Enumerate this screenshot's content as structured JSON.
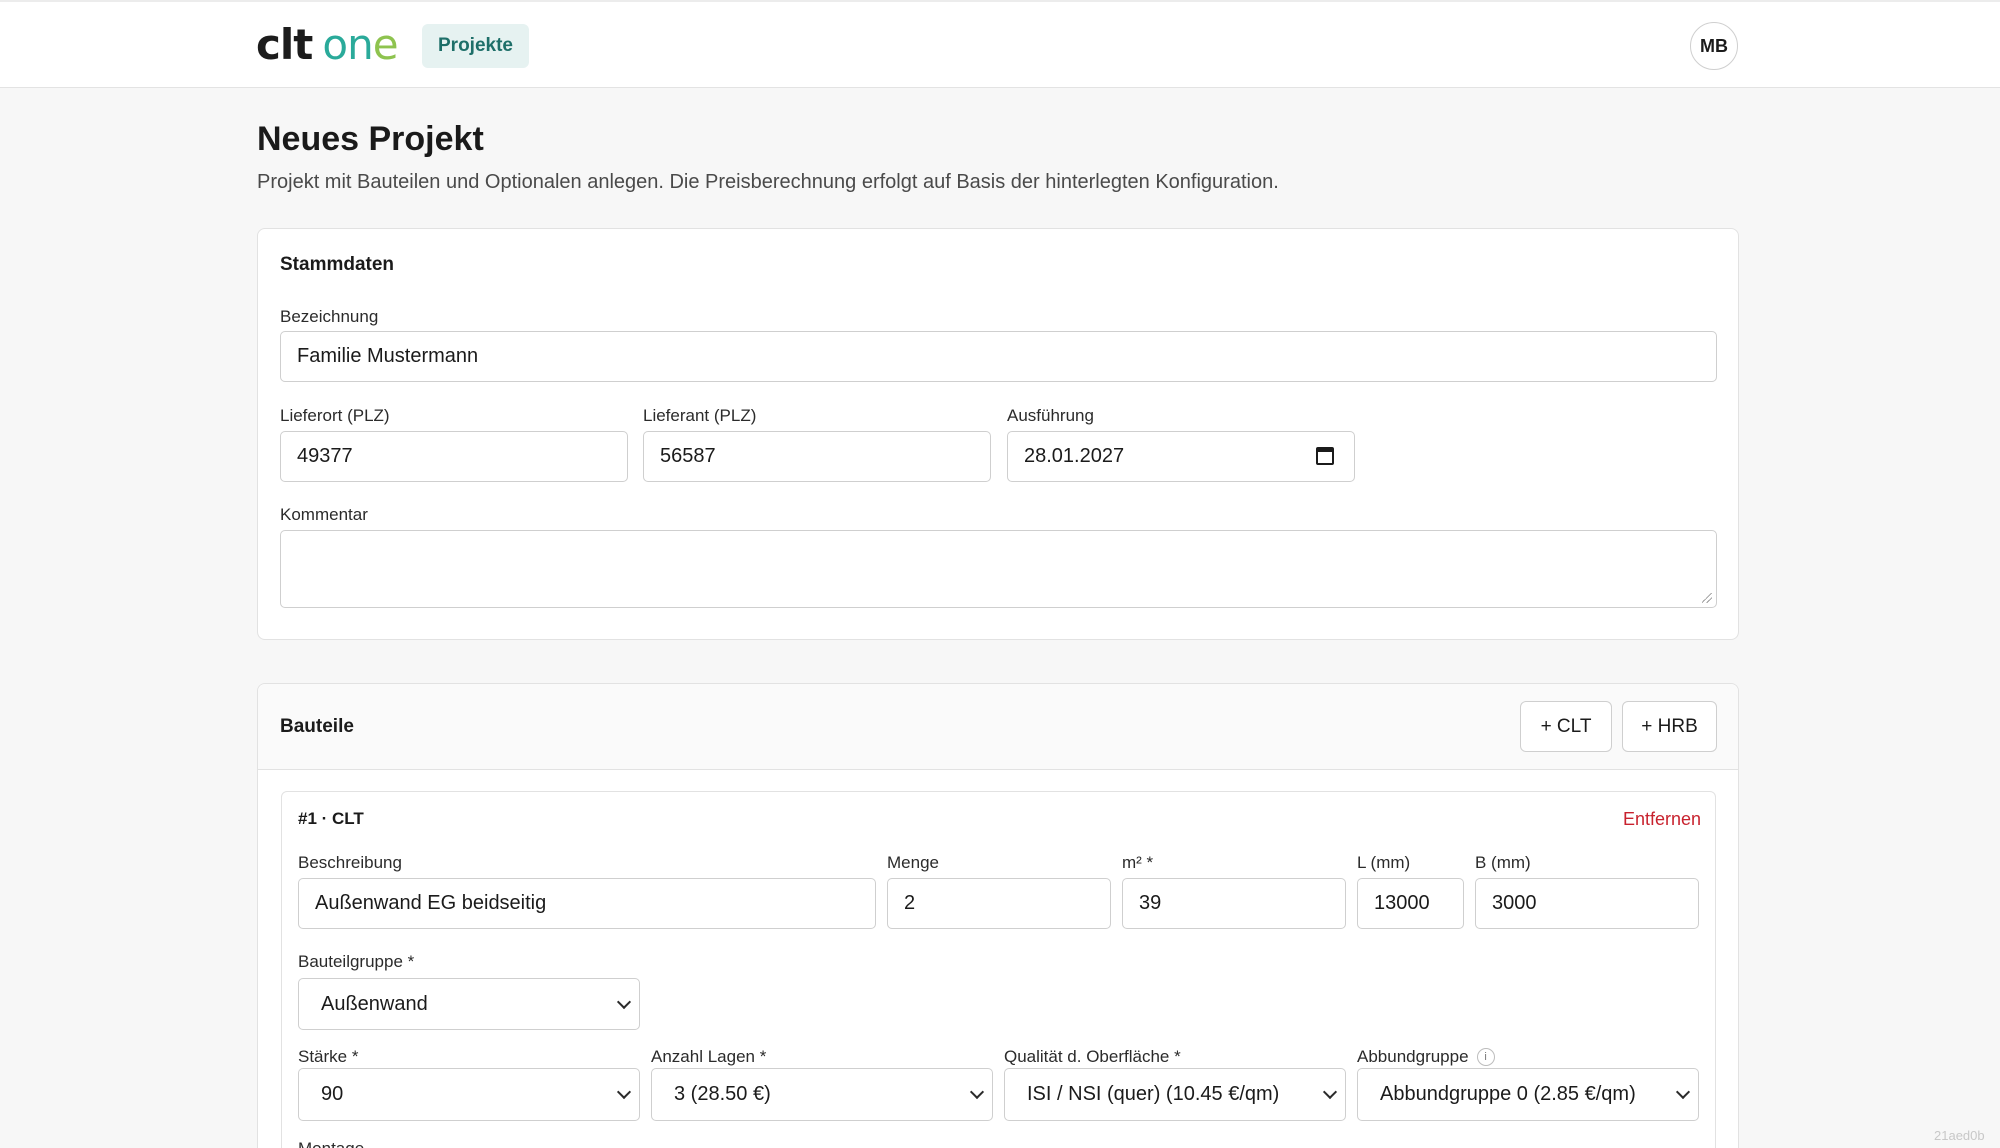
{
  "header": {
    "logo_primary": "clt",
    "logo_secondary_main": "on",
    "logo_secondary_end": "e",
    "nav_projects": "Projekte",
    "avatar_initials": "MB"
  },
  "page": {
    "title": "Neues Projekt",
    "subtitle": "Projekt mit Bauteilen und Optionalen anlegen. Die Preisberechnung erfolgt auf Basis der hinterlegten Konfiguration."
  },
  "stammdaten": {
    "title": "Stammdaten",
    "bezeichnung_label": "Bezeichnung",
    "bezeichnung_value": "Familie Mustermann",
    "lieferort_label": "Lieferort (PLZ)",
    "lieferort_value": "49377",
    "lieferant_label": "Lieferant (PLZ)",
    "lieferant_value": "56587",
    "ausfuehrung_label": "Ausführung",
    "ausfuehrung_value": "28.01.2027",
    "kommentar_label": "Kommentar",
    "kommentar_value": ""
  },
  "bauteile": {
    "title": "Bauteile",
    "add_clt": "+ CLT",
    "add_hrb": "+ HRB",
    "items": [
      {
        "title": "#1 · CLT",
        "remove_label": "Entfernen",
        "beschreibung_label": "Beschreibung",
        "beschreibung_value": "Außenwand EG beidseitig",
        "menge_label": "Menge",
        "menge_value": "2",
        "m2_label": "m² *",
        "m2_value": "39",
        "l_label": "L (mm)",
        "l_value": "13000",
        "b_label": "B (mm)",
        "b_value": "3000",
        "bauteilgruppe_label": "Bauteilgruppe *",
        "bauteilgruppe_value": "Außenwand",
        "staerke_label": "Stärke *",
        "staerke_value": "90",
        "lagen_label": "Anzahl Lagen *",
        "lagen_value": "3 (28.50 €)",
        "qualitaet_label": "Qualität d. Oberfläche *",
        "qualitaet_value": "ISI / NSI (quer) (10.45 €/qm)",
        "abbund_label": "Abbundgruppe",
        "abbund_info": "i",
        "abbund_value": "Abbundgruppe 0 (2.85 €/qm)",
        "montage_label": "Montage"
      }
    ]
  },
  "watermark": "21aed0b"
}
